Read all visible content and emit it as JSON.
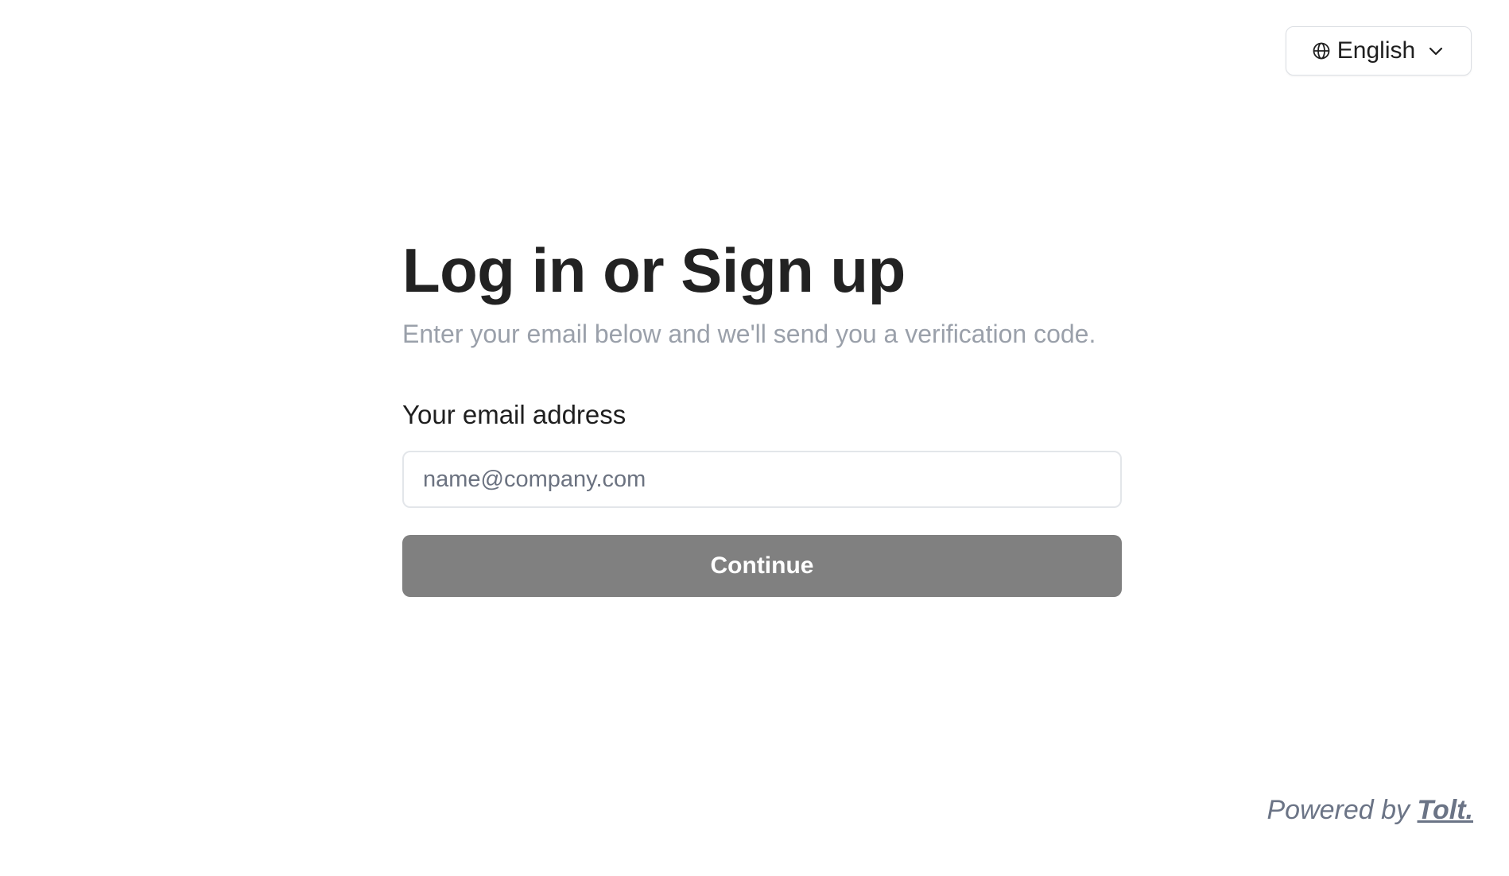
{
  "language_selector": {
    "label": "English",
    "icon": "globe-icon",
    "chevron_icon": "chevron-down-icon"
  },
  "auth_form": {
    "title": "Log in or Sign up",
    "subtitle": "Enter your email below and we'll send you a verification code.",
    "email_label": "Your email address",
    "email_placeholder": "name@company.com",
    "email_value": "",
    "continue_label": "Continue"
  },
  "footer": {
    "powered_by": "Powered by",
    "brand": "Tolt."
  },
  "colors": {
    "button_bg": "#808080",
    "subtitle": "#9aa0aa",
    "footer": "#6b7486"
  }
}
